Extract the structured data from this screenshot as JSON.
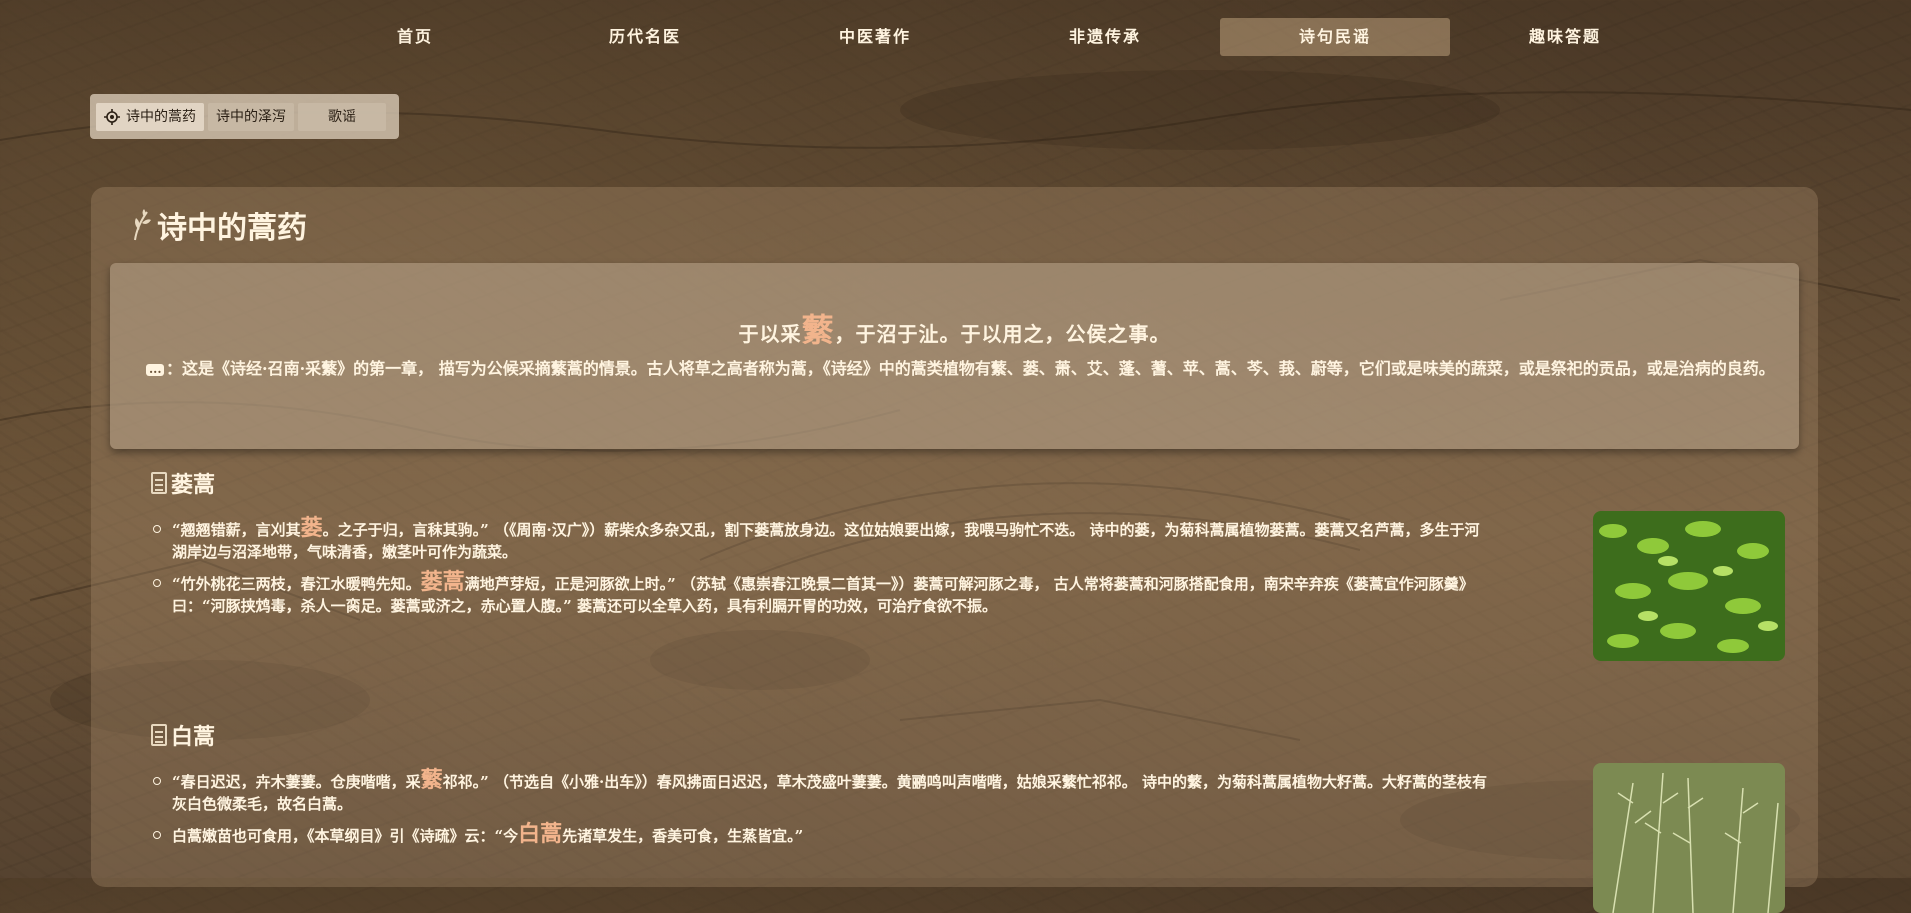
{
  "nav": {
    "items": [
      "首页",
      "历代名医",
      "中医著作",
      "非遗传承",
      "诗句民谣",
      "趣味答题"
    ],
    "active_index": 4
  },
  "subtabs": {
    "items": [
      "诗中的蒿药",
      "诗中的泽泻",
      "歌谣"
    ],
    "active_index": 0
  },
  "section": {
    "title": "诗中的蒿药",
    "poem": {
      "before": "于以采",
      "highlight": "蘩",
      "after": "，于沼于沚。于以用之，公侯之事。"
    },
    "intro": "：这是《诗经·召南·采蘩》的第一章， 描写为公候采摘蘩蒿的情景。古人将草之高者称为蒿，《诗经》中的蒿类植物有蘩、蒌、萧、艾、蓬、蓍、苹、蒿、芩、莪、蔚等，它们或是味美的蔬菜，或是祭祀的贡品，或是治病的良药。"
  },
  "herbs": [
    {
      "name": "蒌蒿",
      "items": [
        {
          "before": "“翘翘错薪，言刈其",
          "highlight": "蒌",
          "after": "。之子于归，言秣其驹。” （《周南·汉广》）薪柴众多杂又乱，割下蒌蒿放身边。这位姑娘要出嫁，我喂马驹忙不迭。 诗中的蒌，为菊科蒿属植物蒌蒿。蒌蒿又名芦蒿，多生于河湖岸边与沼泽地带，气味清香，嫩茎叶可作为蔬菜。"
        },
        {
          "before": "“竹外桃花三两枝，春江水暖鸭先知。",
          "highlight": "蒌蒿",
          "after": "满地芦芽短，正是河豚欲上时。” （苏轼《惠崇春江晚景二首其一》）蒌蒿可解河豚之毒， 古人常将蒌蒿和河豚搭配食用，南宋辛弃疾《蒌蒿宜作河豚羹》曰：“河豚挟鸩毒，杀人一脔足。蒌蒿或济之，赤心置人腹。” 蒌蒿还可以全草入药，具有利膈开胃的功效，可治疗食欲不振。"
        }
      ]
    },
    {
      "name": "白蒿",
      "items": [
        {
          "before": "“春日迟迟，卉木萋萋。仓庚喈喈，采",
          "highlight": "蘩",
          "after": "祁祁。” （节选自《小雅·出车》）春风拂面日迟迟，草木茂盛叶萋萋。黄鹂鸣叫声喈喈，姑娘采蘩忙祁祁。 诗中的蘩，为菊科蒿属植物大籽蒿。大籽蒿的茎枝有灰白色微柔毛，故名白蒿。"
        },
        {
          "before": "白蒿嫩苗也可食用，《本草纲目》引《诗疏》云：“今",
          "highlight": "白蒿",
          "after": "先诸草发生，香美可食，生蒸皆宜。”"
        }
      ]
    }
  ],
  "colors": {
    "accent": "#f2b48c",
    "text": "#fff4e0",
    "nav_active": "#c9a982"
  }
}
